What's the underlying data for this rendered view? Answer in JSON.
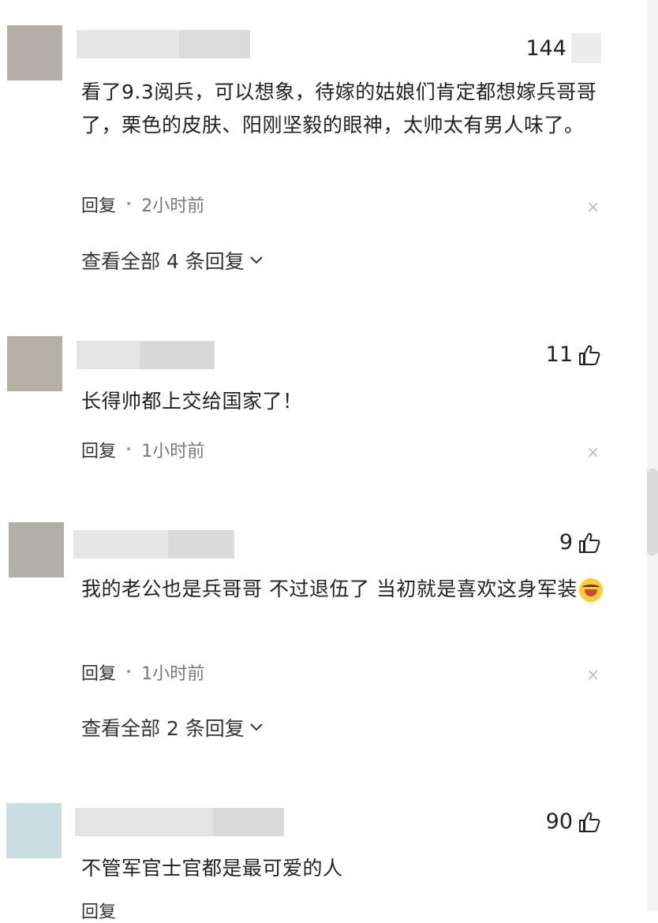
{
  "comments": [
    {
      "likes": "144",
      "text": "看了9.3阅兵，可以想象，待嫁的姑娘们肯定都想嫁兵哥哥了，栗色的皮肤、阳刚坚毅的眼神，太帅太有男人味了。",
      "reply_label": "回复",
      "time": "2小时前",
      "close": "×",
      "view_replies": "查看全部 4 条回复",
      "avatar_color": "#b3aea8"
    },
    {
      "likes": "11",
      "text": "长得帅都上交给国家了！",
      "reply_label": "回复",
      "time": "1小时前",
      "close": "×",
      "avatar_color": "#b5b0a6"
    },
    {
      "likes": "9",
      "text": "我的老公也是兵哥哥 不过退伍了 当初就是喜欢这身军装",
      "reply_label": "回复",
      "time": "1小时前",
      "close": "×",
      "view_replies": "查看全部 2 条回复",
      "avatar_color": "#b2aea9",
      "emoji_icon": "laughing-crying-emoji"
    },
    {
      "likes": "90",
      "text": "不管军官士官都是最可爱的人",
      "reply_label": "回复",
      "avatar_color": "#c9dde3"
    }
  ],
  "icons": {
    "like": "thumbs-up-icon",
    "expand": "chevron-down-icon",
    "dismiss": "close-icon"
  }
}
